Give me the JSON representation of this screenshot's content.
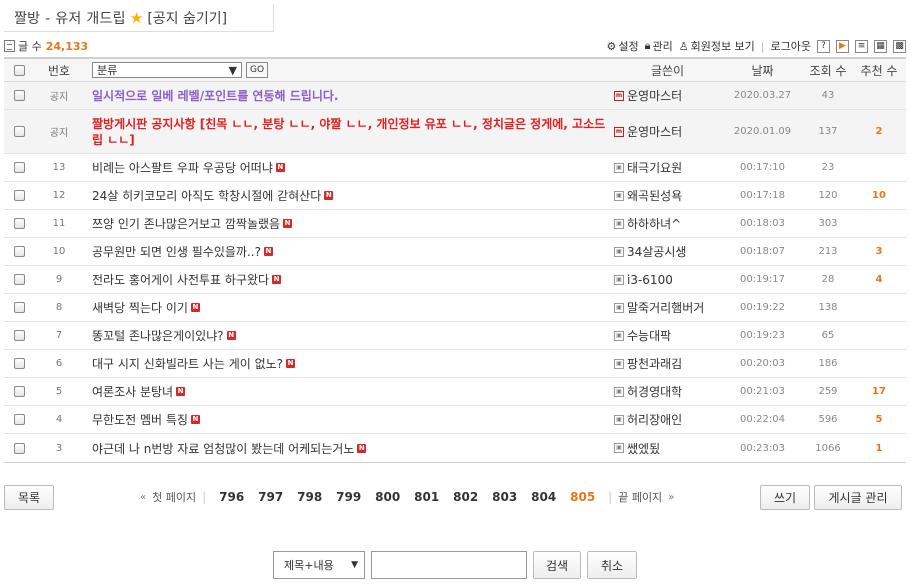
{
  "board": {
    "title": "짤방 - 유저 개드립",
    "star": "★",
    "notice_toggle": "[공지 숨기기]"
  },
  "info": {
    "count_label": "글 수",
    "count_value": "24,133",
    "links": {
      "settings": "설정",
      "manage": "관리",
      "member_info": "회원정보 보기",
      "logout": "로그아웃"
    }
  },
  "table": {
    "headers": {
      "number": "번호",
      "category": "분류",
      "go": "GO",
      "author": "글쓴이",
      "date": "날짜",
      "views": "조회 수",
      "recommend": "추천 수"
    },
    "notices": [
      {
        "no": "공지",
        "subject": "일시적으로 일베 레벨/포인트를 연동해 드립니다.",
        "author": "운영마스터",
        "date": "2020.03.27",
        "views": "43",
        "rec": ""
      },
      {
        "no": "공지",
        "subject": "짤방게시판 공지사항 [친목 ㄴㄴ, 분탕 ㄴㄴ, 야짤 ㄴㄴ, 개인정보 유포 ㄴㄴ, 정치글은 정게에, 고소드립 ㄴㄴ]",
        "author": "운영마스터",
        "date": "2020.01.09",
        "views": "137",
        "rec": "2"
      }
    ],
    "rows": [
      {
        "no": "13",
        "subject": "비례는 아스팔트 우파 우공당 어떠냐",
        "author": "태극기요원",
        "date": "00:17:10",
        "views": "23",
        "rec": ""
      },
      {
        "no": "12",
        "subject": "24살 히키코모리 아직도 학창시절에 갇혀산다",
        "author": "왜곡된성욕",
        "date": "00:17:18",
        "views": "120",
        "rec": "10"
      },
      {
        "no": "11",
        "subject": "쯔양 인기 존나많은거보고 깜짝놀랬음",
        "author": "하하하녀^",
        "date": "00:18:03",
        "views": "303",
        "rec": ""
      },
      {
        "no": "10",
        "subject": "공무원만 되면 인생 필수있을까..?",
        "author": "34살공시생",
        "date": "00:18:07",
        "views": "213",
        "rec": "3"
      },
      {
        "no": "9",
        "subject": "전라도 홍어게이 사전투표 하구왔다",
        "author": "i3-6100",
        "date": "00:19:17",
        "views": "28",
        "rec": "4"
      },
      {
        "no": "8",
        "subject": "새벽당 찍는다 이기",
        "author": "말죽거리햄버거",
        "date": "00:19:22",
        "views": "138",
        "rec": ""
      },
      {
        "no": "7",
        "subject": "똥꼬털 존나많은게이있냐?",
        "author": "수능대팍",
        "date": "00:19:23",
        "views": "65",
        "rec": ""
      },
      {
        "no": "6",
        "subject": "대구 시지 신화빌라트 사는 게이 없노?",
        "author": "팡천과래김",
        "date": "00:20:03",
        "views": "186",
        "rec": ""
      },
      {
        "no": "5",
        "subject": "여론조사 분탕녀",
        "author": "허경영대학",
        "date": "00:21:03",
        "views": "259",
        "rec": "17"
      },
      {
        "no": "4",
        "subject": "무한도전 멤버 특징",
        "author": "허리장애인",
        "date": "00:22:04",
        "views": "596",
        "rec": "5"
      },
      {
        "no": "3",
        "subject": "야근데 나 n번방 자료 엄청많이 봤는데 어케되는거노",
        "author": "쌨엤됬",
        "date": "00:23:03",
        "views": "1066",
        "rec": "1"
      }
    ]
  },
  "badge": {
    "new": "N",
    "admin_icon": "m"
  },
  "bottom": {
    "list_button": "목록",
    "first_page": "첫 페이지",
    "last_page": "끝 페이지",
    "pages": [
      "796",
      "797",
      "798",
      "799",
      "800",
      "801",
      "802",
      "803",
      "804",
      "805"
    ],
    "current_page": "805",
    "write_button": "쓰기",
    "manage_button": "게시글 관리"
  },
  "search": {
    "scope": "제목+내용",
    "value": "",
    "search_button": "검색",
    "cancel_button": "취소"
  },
  "colors": {
    "accent": "#e8761c",
    "notice_red": "#e02020",
    "notice_purple": "#8a5fc9",
    "new_badge": "#d42a2a"
  }
}
